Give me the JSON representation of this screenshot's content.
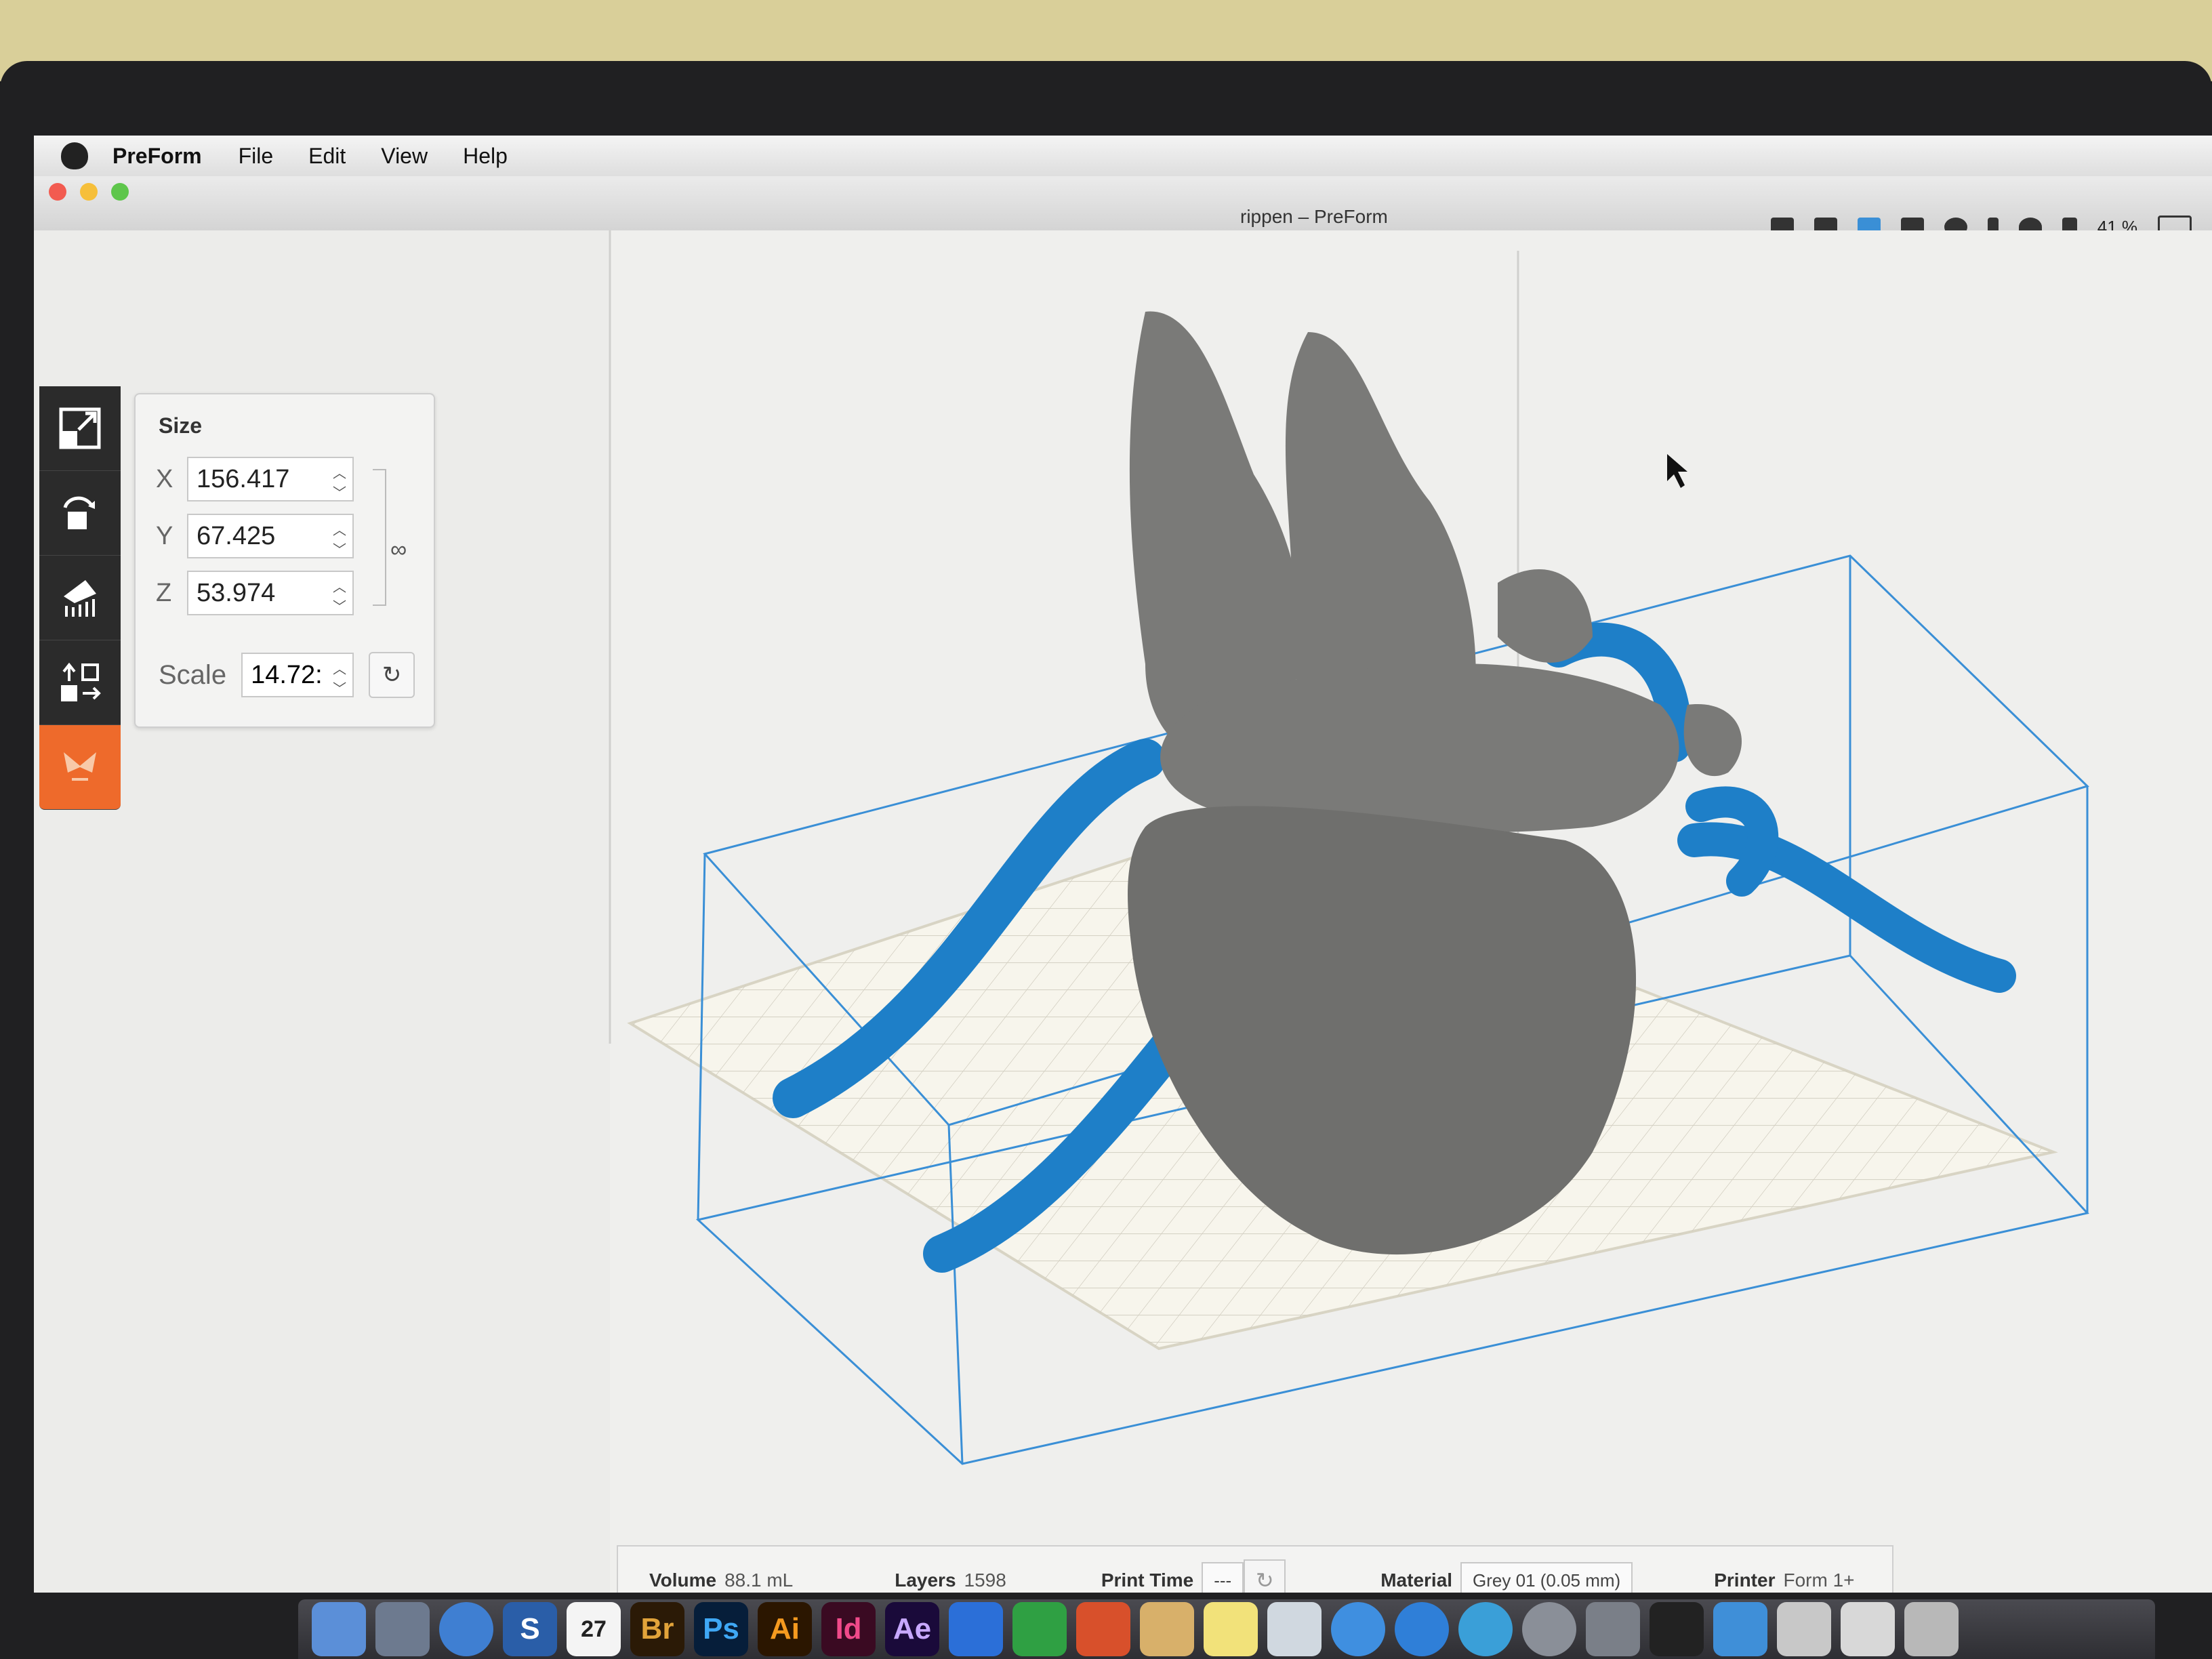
{
  "menubar": {
    "app_name": "PreForm",
    "menus": [
      "File",
      "Edit",
      "View",
      "Help"
    ],
    "battery": "41 %"
  },
  "window": {
    "title": "rippen – PreForm"
  },
  "size_panel": {
    "title": "Size",
    "x_label": "X",
    "x_value": "156.417",
    "y_label": "Y",
    "y_value": "67.425",
    "z_label": "Z",
    "z_value": "53.974",
    "scale_label": "Scale",
    "scale_value": "14.72:"
  },
  "info_bar": {
    "volume_label": "Volume",
    "volume_value": "88.1 mL",
    "layers_label": "Layers",
    "layers_value": "1598",
    "print_time_label": "Print Time",
    "print_time_value": "---",
    "material_label": "Material",
    "material_value": "Grey 01 (0.05 mm)",
    "printer_label": "Printer",
    "printer_value": "Form 1+"
  },
  "dock": {
    "calendar_day": "27",
    "apps": [
      "Br",
      "Ps",
      "Ai",
      "Id",
      "Ae"
    ]
  },
  "colors": {
    "accent": "#ee6a2b",
    "support_blue": "#1e7fc8",
    "model_grey": "#7a7a78",
    "build_box": "#3a8fd6"
  }
}
